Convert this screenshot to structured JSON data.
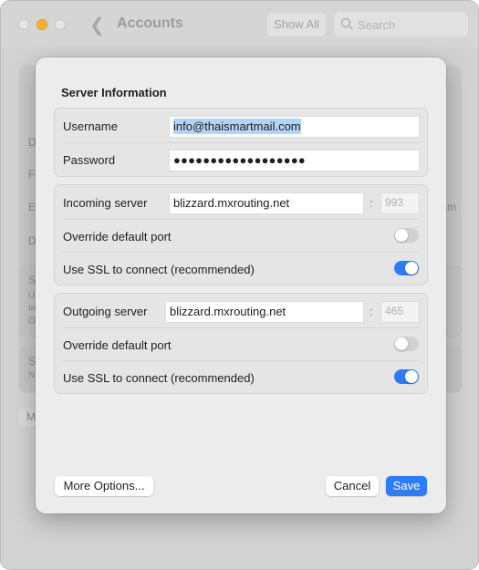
{
  "window": {
    "title": "Accounts",
    "show_all_label": "Show All",
    "search_placeholder": "Search"
  },
  "background": {
    "hidden_letters": [
      "D",
      "F",
      "E",
      "D",
      "S",
      "U",
      "In",
      "O",
      "S",
      "N"
    ],
    "hidden_button": "M",
    "hidden_right": "m"
  },
  "sheet": {
    "section_title": "Server Information",
    "account": {
      "username_label": "Username",
      "username_value": "info@thaismartmail.com",
      "password_label": "Password",
      "password_value": "●●●●●●●●●●●●●●●●●●"
    },
    "incoming": {
      "server_label": "Incoming server",
      "server_value": "blizzard.mxrouting.net",
      "port_value": "993",
      "override_label": "Override default port",
      "override_on": false,
      "ssl_label": "Use SSL to connect (recommended)",
      "ssl_on": true
    },
    "outgoing": {
      "server_label": "Outgoing server",
      "server_value": "blizzard.mxrouting.net",
      "port_value": "465",
      "override_label": "Override default port",
      "override_on": false,
      "ssl_label": "Use SSL to connect (recommended)",
      "ssl_on": true
    },
    "buttons": {
      "more_options": "More Options...",
      "cancel": "Cancel",
      "save": "Save"
    }
  },
  "colors": {
    "accent": "#2e7cf6",
    "selection": "#b4d4f6",
    "minimize_light": "#f6b331"
  }
}
